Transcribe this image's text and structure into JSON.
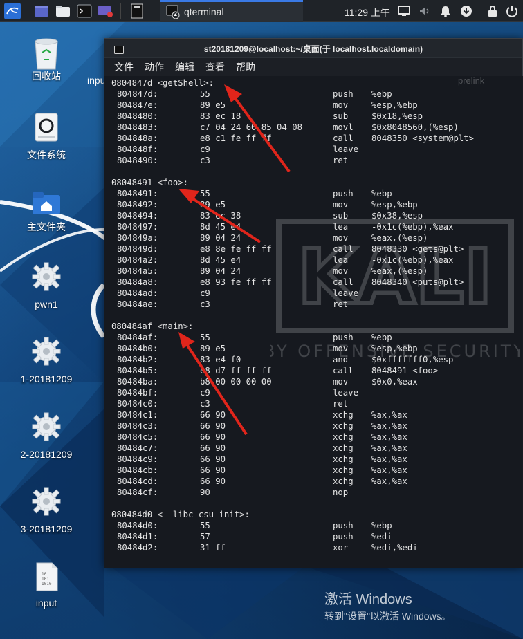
{
  "panel": {
    "taskbar_title": "qterminal",
    "taskbar_badge": "2",
    "clock": "11:29 上午"
  },
  "desktop": {
    "icons": [
      {
        "label": "回收站",
        "icon": "trash-icon"
      },
      {
        "label": "文件系统",
        "icon": "drive-icon"
      },
      {
        "label": "主文件夹",
        "icon": "home-folder-icon"
      },
      {
        "label": "pwn1",
        "icon": "gear-icon"
      },
      {
        "label": "1-20181209",
        "icon": "gear-icon"
      },
      {
        "label": "2-20181209",
        "icon": "gear-icon"
      },
      {
        "label": "3-20181209",
        "icon": "gear-icon"
      },
      {
        "label": "input",
        "icon": "binary-file-icon"
      }
    ],
    "partial_icon_label": "inpu",
    "faded_label": "prelink",
    "activation": {
      "title": "激活 Windows",
      "subtitle": "转到\"设置\"以激活 Windows。"
    }
  },
  "terminal": {
    "title": "st20181209@localhost:~/桌面(于 localhost.localdomain)",
    "menu": [
      "文件",
      "动作",
      "编辑",
      "查看",
      "帮助"
    ],
    "watermark": "KALI",
    "watermark_sub": "BY OFFENSIVE SECURITY",
    "lines": [
      {
        "label": "0804847d <getShell>:"
      },
      {
        "addr": "804847d:",
        "bytes": "55",
        "op": "push",
        "args": "%ebp"
      },
      {
        "addr": "804847e:",
        "bytes": "89 e5",
        "op": "mov",
        "args": "%esp,%ebp"
      },
      {
        "addr": "8048480:",
        "bytes": "83 ec 18",
        "op": "sub",
        "args": "$0x18,%esp"
      },
      {
        "addr": "8048483:",
        "bytes": "c7 04 24 60 85 04 08",
        "op": "movl",
        "args": "$0x8048560,(%esp)"
      },
      {
        "addr": "804848a:",
        "bytes": "e8 c1 fe ff ff",
        "op": "call",
        "args": "8048350 <system@plt>"
      },
      {
        "addr": "804848f:",
        "bytes": "c9",
        "op": "leave",
        "args": ""
      },
      {
        "addr": "8048490:",
        "bytes": "c3",
        "op": "ret",
        "args": ""
      },
      {},
      {
        "label": "08048491 <foo>:"
      },
      {
        "addr": "8048491:",
        "bytes": "55",
        "op": "push",
        "args": "%ebp"
      },
      {
        "addr": "8048492:",
        "bytes": "89 e5",
        "op": "mov",
        "args": "%esp,%ebp"
      },
      {
        "addr": "8048494:",
        "bytes": "83 ec 38",
        "op": "sub",
        "args": "$0x38,%esp"
      },
      {
        "addr": "8048497:",
        "bytes": "8d 45 e4",
        "op": "lea",
        "args": "-0x1c(%ebp),%eax"
      },
      {
        "addr": "804849a:",
        "bytes": "89 04 24",
        "op": "mov",
        "args": "%eax,(%esp)"
      },
      {
        "addr": "804849d:",
        "bytes": "e8 8e fe ff ff",
        "op": "call",
        "args": "8048330 <gets@plt>"
      },
      {
        "addr": "80484a2:",
        "bytes": "8d 45 e4",
        "op": "lea",
        "args": "-0x1c(%ebp),%eax"
      },
      {
        "addr": "80484a5:",
        "bytes": "89 04 24",
        "op": "mov",
        "args": "%eax,(%esp)"
      },
      {
        "addr": "80484a8:",
        "bytes": "e8 93 fe ff ff",
        "op": "call",
        "args": "8048340 <puts@plt>"
      },
      {
        "addr": "80484ad:",
        "bytes": "c9",
        "op": "leave",
        "args": ""
      },
      {
        "addr": "80484ae:",
        "bytes": "c3",
        "op": "ret",
        "args": ""
      },
      {},
      {
        "label": "080484af <main>:"
      },
      {
        "addr": "80484af:",
        "bytes": "55",
        "op": "push",
        "args": "%ebp"
      },
      {
        "addr": "80484b0:",
        "bytes": "89 e5",
        "op": "mov",
        "args": "%esp,%ebp"
      },
      {
        "addr": "80484b2:",
        "bytes": "83 e4 f0",
        "op": "and",
        "args": "$0xfffffff0,%esp"
      },
      {
        "addr": "80484b5:",
        "bytes": "e8 d7 ff ff ff",
        "op": "call",
        "args": "8048491 <foo>"
      },
      {
        "addr": "80484ba:",
        "bytes": "b8 00 00 00 00",
        "op": "mov",
        "args": "$0x0,%eax"
      },
      {
        "addr": "80484bf:",
        "bytes": "c9",
        "op": "leave",
        "args": ""
      },
      {
        "addr": "80484c0:",
        "bytes": "c3",
        "op": "ret",
        "args": ""
      },
      {
        "addr": "80484c1:",
        "bytes": "66 90",
        "op": "xchg",
        "args": "%ax,%ax"
      },
      {
        "addr": "80484c3:",
        "bytes": "66 90",
        "op": "xchg",
        "args": "%ax,%ax"
      },
      {
        "addr": "80484c5:",
        "bytes": "66 90",
        "op": "xchg",
        "args": "%ax,%ax"
      },
      {
        "addr": "80484c7:",
        "bytes": "66 90",
        "op": "xchg",
        "args": "%ax,%ax"
      },
      {
        "addr": "80484c9:",
        "bytes": "66 90",
        "op": "xchg",
        "args": "%ax,%ax"
      },
      {
        "addr": "80484cb:",
        "bytes": "66 90",
        "op": "xchg",
        "args": "%ax,%ax"
      },
      {
        "addr": "80484cd:",
        "bytes": "66 90",
        "op": "xchg",
        "args": "%ax,%ax"
      },
      {
        "addr": "80484cf:",
        "bytes": "90",
        "op": "nop",
        "args": ""
      },
      {},
      {
        "label": "080484d0 <__libc_csu_init>:"
      },
      {
        "addr": "80484d0:",
        "bytes": "55",
        "op": "push",
        "args": "%ebp"
      },
      {
        "addr": "80484d1:",
        "bytes": "57",
        "op": "push",
        "args": "%edi"
      },
      {
        "addr": "80484d2:",
        "bytes": "31 ff",
        "op": "xor",
        "args": "%edi,%edi"
      }
    ]
  },
  "colors": {
    "arrow": "#e0251b",
    "taskbar_accent": "#3a7ae6"
  }
}
